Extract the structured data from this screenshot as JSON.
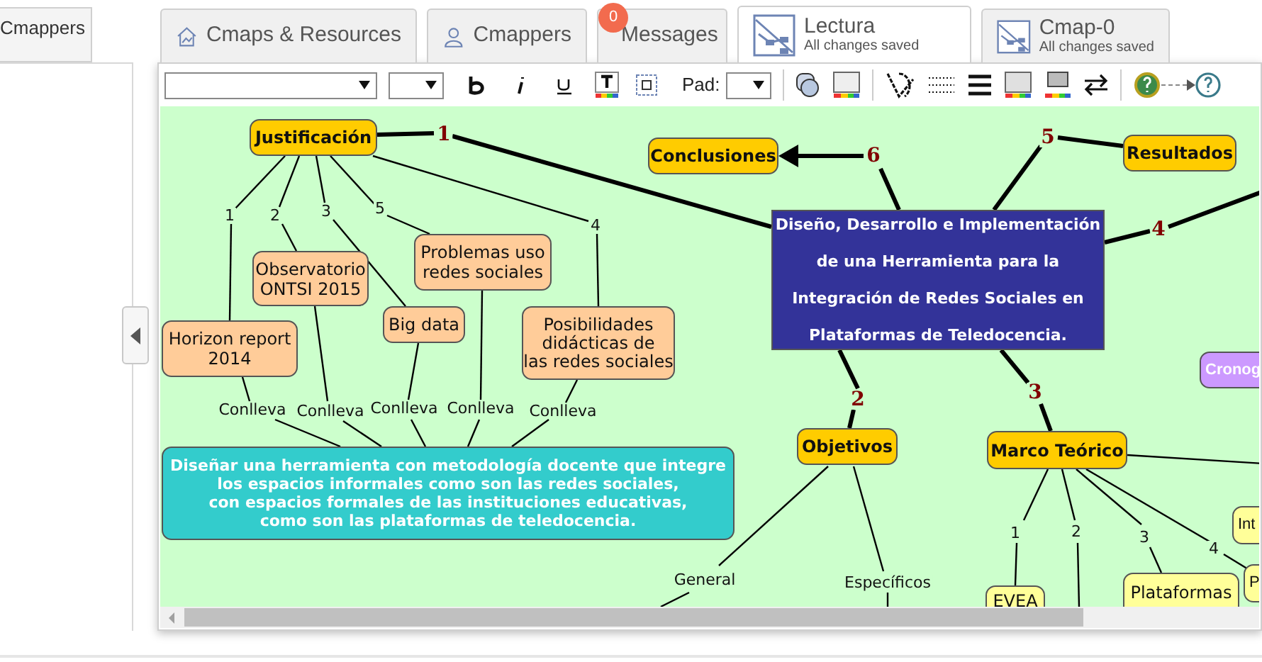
{
  "side_panel": {
    "tab": "Cmappers"
  },
  "tabs": [
    {
      "label": "Cmaps & Resources",
      "kind": "resources",
      "selected": false
    },
    {
      "label": "Cmappers",
      "kind": "people",
      "selected": false
    },
    {
      "label": "Messages",
      "kind": "messages",
      "badge": "0",
      "selected": false
    },
    {
      "label": "Lectura",
      "status": "All changes saved",
      "kind": "map",
      "selected": true
    },
    {
      "label": "Cmap-0",
      "status": "All changes saved",
      "kind": "map",
      "selected": false
    }
  ],
  "toolbar": {
    "pad_label": "Pad:"
  },
  "map": {
    "concepts": [
      {
        "text": "Justificación",
        "color": "#ffcc00"
      },
      {
        "text": "Conclusiones",
        "color": "#ffcc00"
      },
      {
        "text": "Resultados",
        "color": "#ffcc00"
      },
      {
        "text": "Diseño, Desarrollo e Implementación\nde una Herramienta para la\nIntegración de Redes Sociales en\nPlataformas de Teledocencia.",
        "color": "#333399"
      },
      {
        "text": "Cronog",
        "color": "#cc99ff"
      },
      {
        "text": "Objetivos",
        "color": "#ffcc00"
      },
      {
        "text": "Marco Teórico",
        "color": "#ffcc00"
      },
      {
        "text": "Observatorio\nONTSI 2015",
        "color": "#ffcc99"
      },
      {
        "text": "Problemas uso\nredes sociales",
        "color": "#ffcc99"
      },
      {
        "text": "Big data",
        "color": "#ffcc99"
      },
      {
        "text": "Horizon report\n2014",
        "color": "#ffcc99"
      },
      {
        "text": "Posibilidades\ndidácticas de\nlas redes sociales",
        "color": "#ffcc99"
      },
      {
        "text": "Diseñar una herramienta con metodología docente que integre\nlos espacios informales como son las redes sociales,\ncon espacios formales de las instituciones educativas,\ncomo son las plataformas de teledocencia.",
        "color": "#33cccc"
      },
      {
        "text": "Int",
        "color": "#ffff99"
      },
      {
        "text": "P",
        "color": "#ffff99"
      },
      {
        "text": "Plataformas",
        "color": "#ffff99"
      },
      {
        "text": "EVEA",
        "color": "#ffff99"
      }
    ],
    "linking_phrases": [
      {
        "text": "1",
        "kind": "major"
      },
      {
        "text": "6",
        "kind": "major"
      },
      {
        "text": "5",
        "kind": "major"
      },
      {
        "text": "4",
        "kind": "major"
      },
      {
        "text": "2",
        "kind": "major"
      },
      {
        "text": "3",
        "kind": "major"
      },
      {
        "text": "1",
        "kind": "minor"
      },
      {
        "text": "2",
        "kind": "minor"
      },
      {
        "text": "3",
        "kind": "minor"
      },
      {
        "text": "5",
        "kind": "minor"
      },
      {
        "text": "4",
        "kind": "minor"
      },
      {
        "text": "Conlleva",
        "kind": "minor"
      },
      {
        "text": "Conlleva",
        "kind": "minor"
      },
      {
        "text": "Conlleva",
        "kind": "minor"
      },
      {
        "text": "Conlleva",
        "kind": "minor"
      },
      {
        "text": "Conlleva",
        "kind": "minor"
      },
      {
        "text": "General",
        "kind": "minor"
      },
      {
        "text": "Específicos",
        "kind": "minor"
      },
      {
        "text": "1",
        "kind": "minor"
      },
      {
        "text": "2",
        "kind": "minor"
      },
      {
        "text": "3",
        "kind": "minor"
      },
      {
        "text": "4",
        "kind": "minor"
      }
    ]
  }
}
